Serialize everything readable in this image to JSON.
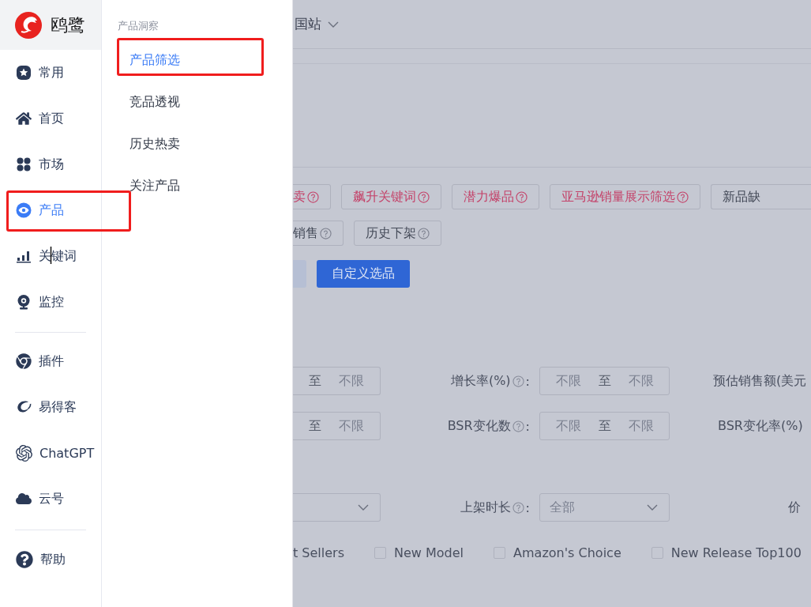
{
  "logo": {
    "name": "鸥鹭"
  },
  "sidebar": {
    "groups": [
      [
        {
          "label": "常用",
          "selected": false
        },
        {
          "label": "首页",
          "selected": false
        },
        {
          "label": "市场",
          "selected": false
        },
        {
          "label": "产品",
          "selected": true
        },
        {
          "label": "关键词",
          "selected": false
        },
        {
          "label": "监控",
          "selected": false
        }
      ],
      [
        {
          "label": "插件",
          "selected": false
        },
        {
          "label": "易得客",
          "selected": false
        },
        {
          "label": "ChatGPT",
          "selected": false
        },
        {
          "label": "云号",
          "selected": false
        }
      ],
      [
        {
          "label": "帮助",
          "selected": false
        }
      ]
    ]
  },
  "submenu": {
    "heading": "产品洞察",
    "items": [
      {
        "label": "产品筛选",
        "selected": true
      },
      {
        "label": "竞品透视",
        "selected": false
      },
      {
        "label": "历史热卖",
        "selected": false
      },
      {
        "label": "关注产品",
        "selected": false
      }
    ]
  },
  "main": {
    "site": "国站",
    "quick_filters": [
      [
        {
          "label": "卖",
          "kind": "hot",
          "help": true
        },
        {
          "label": "飙升关键词",
          "kind": "hot",
          "help": true
        },
        {
          "label": "潜力爆品",
          "kind": "hot",
          "help": true
        },
        {
          "label": "亚马逊销量展示筛选",
          "kind": "hot",
          "help": true
        },
        {
          "label": "新品缺",
          "kind": "plain",
          "help": false
        }
      ],
      [
        {
          "label": "销售",
          "kind": "plain",
          "help": true
        },
        {
          "label": "历史下架",
          "kind": "plain",
          "help": true
        }
      ]
    ],
    "custom_button": "自定义选品",
    "filter_rows": [
      {
        "kind": "range",
        "left": {
          "sep": "至",
          "max": "不限"
        },
        "label": "增长率(%)",
        "colon": ":",
        "field": {
          "min": "不限",
          "sep": "至",
          "max": "不限"
        },
        "right_label": "预估销售额(美元"
      },
      {
        "kind": "range",
        "left": {
          "sep": "至",
          "max": "不限"
        },
        "label": "BSR变化数",
        "colon": ":",
        "field": {
          "min": "不限",
          "sep": "至",
          "max": "不限"
        },
        "right_label": "BSR变化率(%)"
      },
      {
        "kind": "select",
        "label": "上架时长",
        "colon": ":",
        "field": {
          "value": "全部"
        },
        "right_label": "价"
      }
    ],
    "badges": [
      {
        "label": "t Sellers",
        "kind": "text"
      },
      {
        "label": "New Model",
        "kind": "checkbox",
        "checked": false
      },
      {
        "label": "Amazon's Choice",
        "kind": "checkbox",
        "checked": false
      },
      {
        "label": "New Release Top100",
        "kind": "checkbox",
        "checked": false
      }
    ]
  }
}
